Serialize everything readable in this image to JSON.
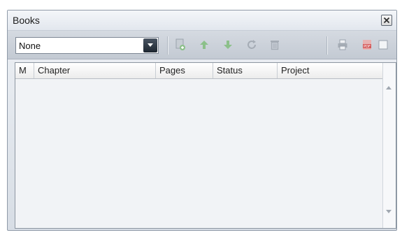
{
  "window": {
    "title": "Books",
    "close_icon": "close-icon"
  },
  "toolbar": {
    "book_select": {
      "value": "None"
    },
    "icons": [
      "add-chapter-icon",
      "move-up-icon",
      "move-down-icon",
      "refresh-icon",
      "delete-icon",
      "print-icon",
      "pdf-icon",
      "checkbox-icon"
    ]
  },
  "table": {
    "columns": [
      {
        "label": "M"
      },
      {
        "label": "Chapter"
      },
      {
        "label": "Pages"
      },
      {
        "label": "Status"
      },
      {
        "label": "Project"
      }
    ],
    "rows": []
  },
  "colors": {
    "panel_bg": "#d7dde5",
    "grid_bg": "#f1f3f6",
    "arrow_green": "#8cc08a",
    "pdf_red": "#d45a5a"
  }
}
